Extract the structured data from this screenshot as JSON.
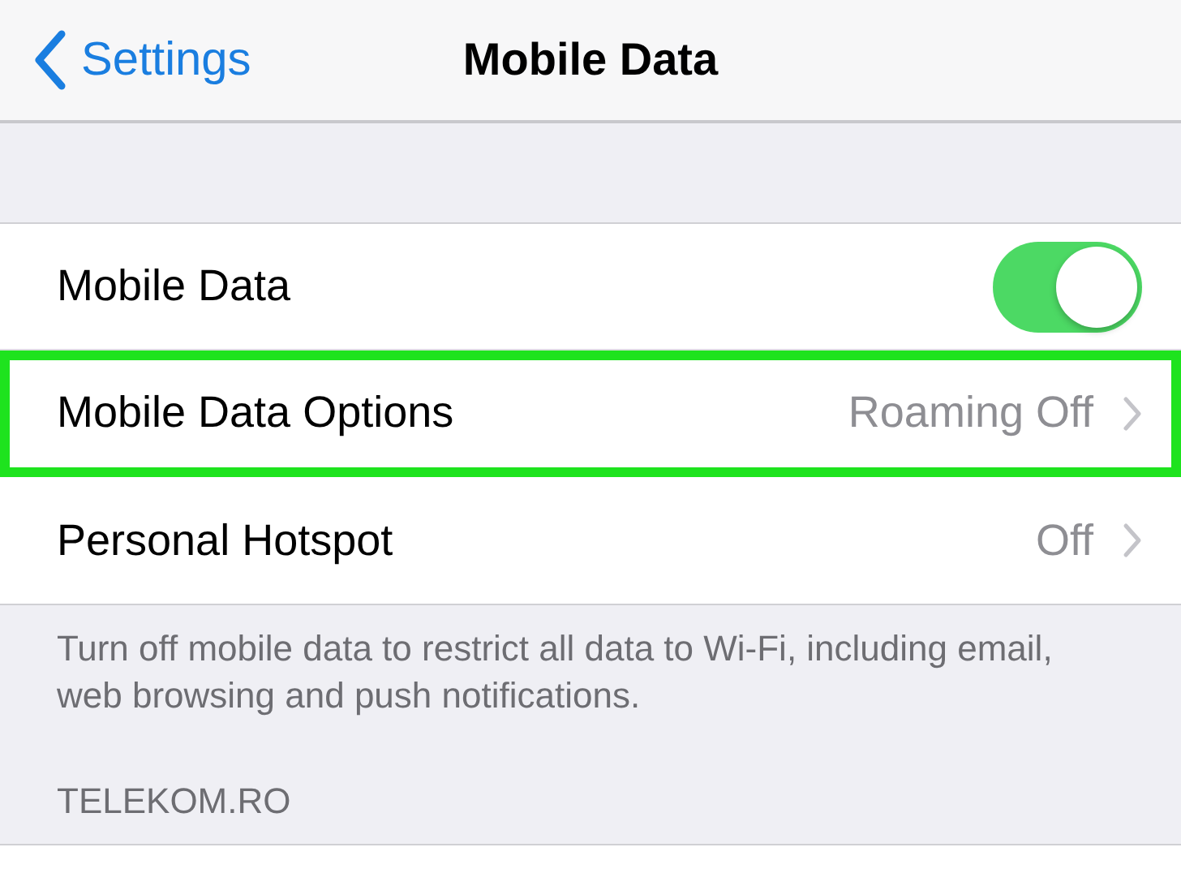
{
  "nav": {
    "back": "Settings",
    "title": "Mobile Data"
  },
  "rows": [
    {
      "kind": "switch",
      "label": "Mobile Data",
      "on": true,
      "highlighted": false
    },
    {
      "kind": "detail",
      "label": "Mobile Data Options",
      "value": "Roaming Off",
      "highlighted": true
    },
    {
      "kind": "detail",
      "label": "Personal Hotspot",
      "value": "Off",
      "highlighted": false
    }
  ],
  "footer": "Turn off mobile data to restrict all data to Wi-Fi, including email, web browsing and push notifications.",
  "section_header": "TELEKOM.RO"
}
